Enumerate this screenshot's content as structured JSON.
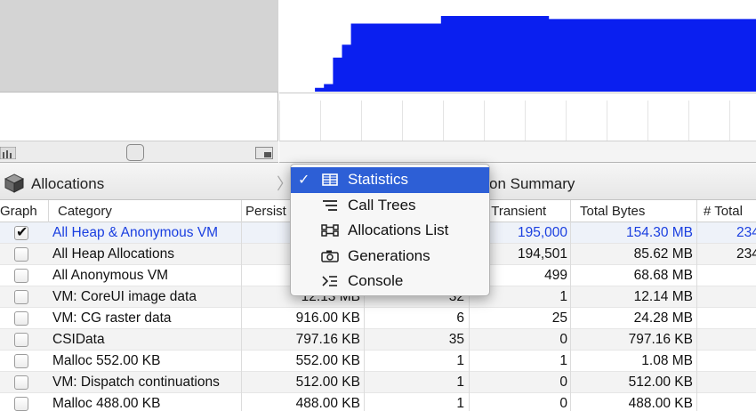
{
  "graph": {
    "fill_color": "#0a1ff0",
    "profile": [
      [
        0.0,
        0.0
      ],
      [
        0.02,
        0.05
      ],
      [
        0.04,
        0.1
      ],
      [
        0.06,
        0.45
      ],
      [
        0.08,
        0.62
      ],
      [
        0.1,
        0.9
      ],
      [
        0.27,
        0.9
      ],
      [
        0.3,
        1.0
      ],
      [
        0.5,
        1.0
      ],
      [
        0.54,
        0.96
      ],
      [
        0.9,
        0.96
      ],
      [
        1.0,
        0.96
      ]
    ]
  },
  "jump_bar": {
    "instrument_name": "Allocations",
    "separator": "〉",
    "summary_title": "on Summary"
  },
  "table": {
    "columns": {
      "graph": "Graph",
      "category": "Category",
      "persistent": "Persist",
      "transient": "# Transient",
      "total_bytes": "Total Bytes",
      "total": "# Total"
    },
    "rows": [
      {
        "checked": true,
        "category": "All Heap & Anonymous VM",
        "persistent": "",
        "count": "",
        "transient": "195,000",
        "total_bytes": "154.30 MB",
        "total": "234",
        "style": "blue"
      },
      {
        "checked": false,
        "category": "All Heap Allocations",
        "persistent": "",
        "count": "",
        "transient": "194,501",
        "total_bytes": "85.62 MB",
        "total": "234",
        "style": "alt"
      },
      {
        "checked": false,
        "category": "All Anonymous VM",
        "persistent": "",
        "count": "",
        "transient": "499",
        "total_bytes": "68.68 MB",
        "total": "",
        "style": ""
      },
      {
        "checked": false,
        "category": "VM: CoreUI image data",
        "persistent": "12.13 MB",
        "count": "32",
        "transient": "1",
        "total_bytes": "12.14 MB",
        "total": "",
        "style": ""
      },
      {
        "checked": false,
        "category": "VM: CG raster data",
        "persistent": "916.00 KB",
        "count": "6",
        "transient": "25",
        "total_bytes": "24.28 MB",
        "total": "",
        "style": ""
      },
      {
        "checked": false,
        "category": "CSIData",
        "persistent": "797.16 KB",
        "count": "35",
        "transient": "0",
        "total_bytes": "797.16 KB",
        "total": "",
        "style": ""
      },
      {
        "checked": false,
        "category": "Malloc 552.00 KB",
        "persistent": "552.00 KB",
        "count": "1",
        "transient": "1",
        "total_bytes": "1.08 MB",
        "total": "",
        "style": ""
      },
      {
        "checked": false,
        "category": "VM: Dispatch continuations",
        "persistent": "512.00 KB",
        "count": "1",
        "transient": "0",
        "total_bytes": "512.00 KB",
        "total": "",
        "style": ""
      },
      {
        "checked": false,
        "category": "Malloc 488.00 KB",
        "persistent": "488.00 KB",
        "count": "1",
        "transient": "0",
        "total_bytes": "488.00 KB",
        "total": "",
        "style": ""
      }
    ]
  },
  "popup_menu": {
    "check_mark": "✓",
    "items": [
      {
        "label": "Statistics",
        "icon": "statistics-icon",
        "selected": true
      },
      {
        "label": "Call Trees",
        "icon": "call-trees-icon",
        "selected": false
      },
      {
        "label": "Allocations List",
        "icon": "allocations-list-icon",
        "selected": false
      },
      {
        "label": "Generations",
        "icon": "generations-camera-icon",
        "selected": false
      },
      {
        "label": "Console",
        "icon": "console-icon",
        "selected": false
      }
    ]
  }
}
